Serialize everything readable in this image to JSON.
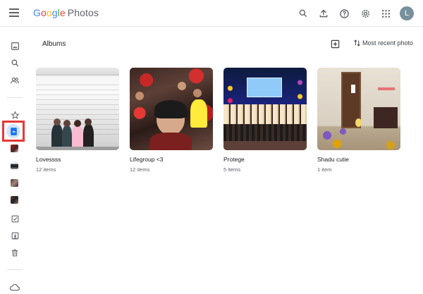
{
  "header": {
    "logo_parts": [
      "G",
      "o",
      "o",
      "g",
      "l",
      "e"
    ],
    "product": "Photos",
    "avatar_letter": "L",
    "icons": [
      "menu-icon",
      "search-icon",
      "upload-icon",
      "help-icon",
      "settings-icon",
      "apps-icon"
    ]
  },
  "sidebar": {
    "items": [
      "photos-icon",
      "search-icon",
      "sharing-icon",
      "favorites-icon",
      "albums-icon",
      "album-thumb-1",
      "album-thumb-2",
      "album-thumb-3",
      "album-thumb-4",
      "utilities-icon",
      "archive-icon",
      "trash-icon",
      "cloud-icon"
    ],
    "active": "albums-icon"
  },
  "main": {
    "title": "Albums",
    "sort_label": "Most recent photo"
  },
  "albums": [
    {
      "title": "Lovessss",
      "count": "12 items"
    },
    {
      "title": "Lifegroup <3",
      "count": "12 items"
    },
    {
      "title": "Protege",
      "count": "5 items"
    },
    {
      "title": "Shadu cutie",
      "count": "1 item"
    }
  ],
  "colors": {
    "accent": "#1a73e8",
    "highlight_box": "#e53935"
  }
}
